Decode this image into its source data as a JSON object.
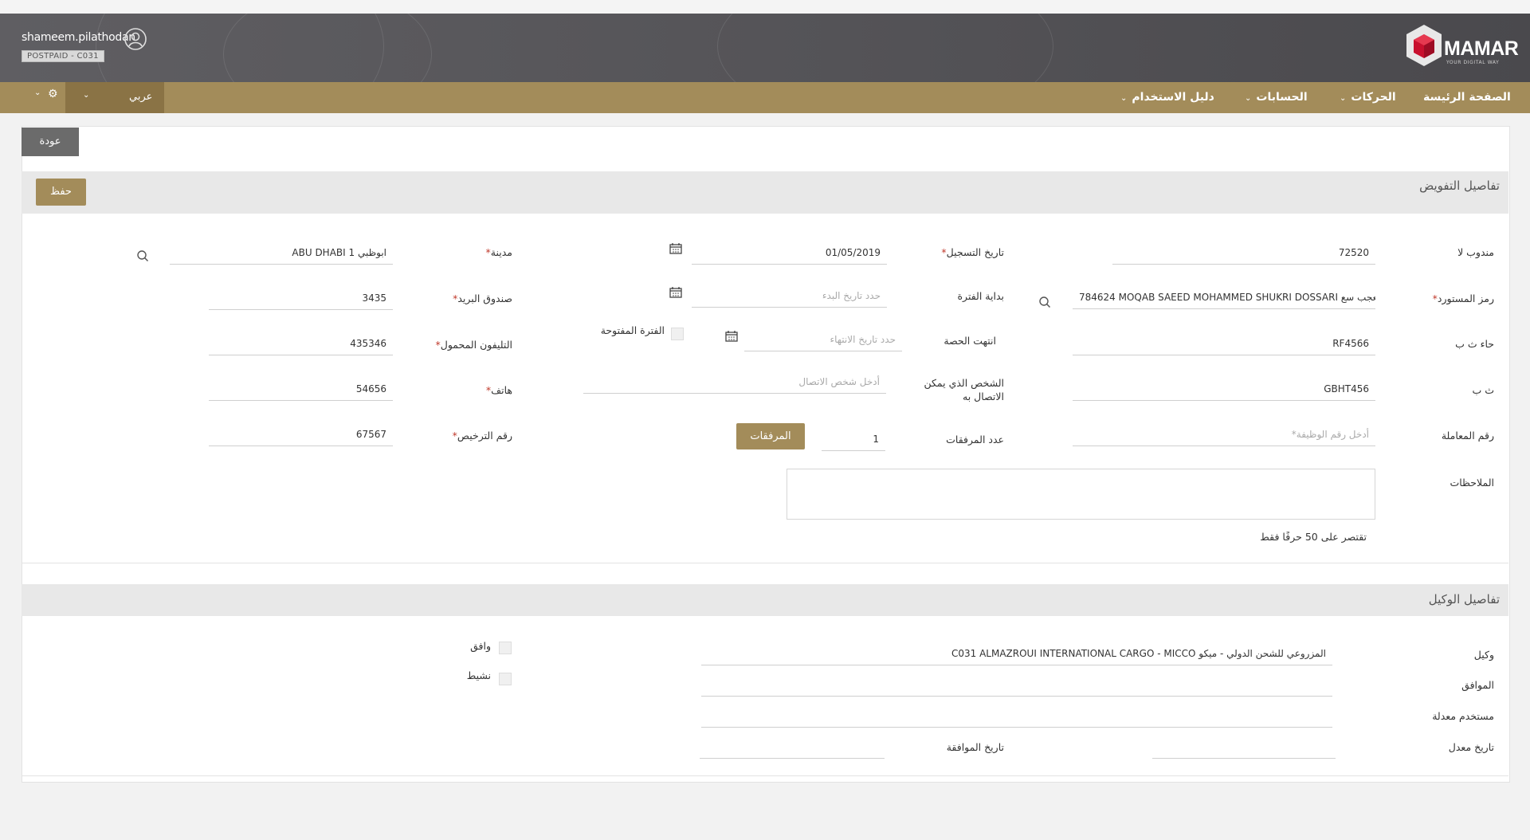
{
  "header": {
    "username": "shameem.pilathodan",
    "plan": "POSTPAID - C031",
    "logo_text": "MAMAR",
    "logo_tagline": "YOUR DIGITAL WAY",
    "user_icon": "user-circle-icon"
  },
  "nav": {
    "items": [
      {
        "label": "الصفحة الرئيسة"
      },
      {
        "label": "الحركات",
        "dropdown": true
      },
      {
        "label": "الحسابات",
        "dropdown": true
      },
      {
        "label": "دليل الاستخدام",
        "dropdown": true
      }
    ],
    "language": "عربي",
    "settings_icon": "gear-icon"
  },
  "back_button": "عودة",
  "auth": {
    "title": "تفاصيل التفويض",
    "save_button": "حفظ",
    "labels": {
      "delegate": "مندوب لا",
      "importer_code": "رمز المستورد",
      "quota_note": "حاء ث ب",
      "tb": "ث ب",
      "transaction_no": "رقم المعاملة",
      "reg_date": "تاريخ التسجيل",
      "period_start": "بداية الفترة",
      "quota_ended": "انتهت الحصة",
      "contact_person": "الشخص الذي يمكن الاتصال به",
      "attachments_count": "عدد المرفقات",
      "open_period": "الفترة المفتوحة",
      "city": "مدينة",
      "po_box": "صندوق البريد",
      "mobile": "التليفون المحمول",
      "phone": "هاتف",
      "license_no": "رقم الترخيص",
      "notes": "الملاحظات"
    },
    "values": {
      "delegate": "72520",
      "importer_code": "784624  MOQAB SAEED MOHAMMED SHUKRI DOSSARI معجب سع",
      "quota_note": "RF4566",
      "tb": "GBHT456",
      "reg_date": "01/05/2019",
      "attachments_count": "1",
      "city": "ABU DHABI 1 ابوظبي",
      "po_box": "3435",
      "mobile": "435346",
      "phone": "54656",
      "license_no": "67567"
    },
    "placeholders": {
      "transaction_no": "*أدخل رقم الوظيفة",
      "period_start": "حدد تاريخ البدء",
      "quota_ended": "حدد تاريخ الانتهاء",
      "contact_person": "أدخل شخص الاتصال"
    },
    "attachments_button": "المرفقات",
    "notes_hint": "تقتصر على 50 حرفًا فقط"
  },
  "agent": {
    "title": "تفاصيل الوكيل",
    "labels": {
      "agent": "وكيل",
      "approver": "الموافق",
      "modified_user": "مستخدم معدلة",
      "modified_date": "تاريخ معدل",
      "approval_date": "تاريخ الموافقة",
      "approved": "وافق",
      "active": "نشيط"
    },
    "values": {
      "agent": "C031 ALMAZROUI INTERNATIONAL CARGO - MICCO المزروعي للشحن الدولي - ميكو"
    }
  },
  "colors": {
    "brand_gold": "#a38c5a",
    "header_gray": "#58575b",
    "required": "#c0392b"
  }
}
